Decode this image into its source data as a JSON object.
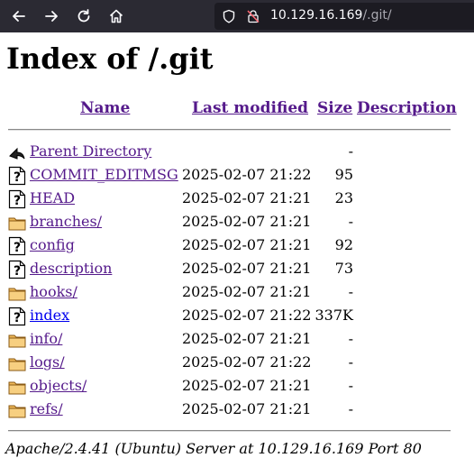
{
  "browser": {
    "url_host": "10.129.16.169",
    "url_path": "/.git/"
  },
  "page": {
    "title": "Index of /.git",
    "columns": {
      "name": "Name",
      "last_modified": "Last modified",
      "size": "Size",
      "description": "Description"
    },
    "rows": [
      {
        "icon": "parent-directory-icon",
        "name": "Parent Directory",
        "date": "",
        "size": "-"
      },
      {
        "icon": "unknown-file-icon",
        "name": "COMMIT_EDITMSG",
        "date": "2025-02-07 21:22",
        "size": "95"
      },
      {
        "icon": "unknown-file-icon",
        "name": "HEAD",
        "date": "2025-02-07 21:21",
        "size": "23"
      },
      {
        "icon": "folder-icon",
        "name": "branches/",
        "date": "2025-02-07 21:21",
        "size": "-"
      },
      {
        "icon": "unknown-file-icon",
        "name": "config",
        "date": "2025-02-07 21:21",
        "size": "92"
      },
      {
        "icon": "unknown-file-icon",
        "name": "description",
        "date": "2025-02-07 21:21",
        "size": "73"
      },
      {
        "icon": "folder-icon",
        "name": "hooks/",
        "date": "2025-02-07 21:21",
        "size": "-"
      },
      {
        "icon": "unknown-file-icon",
        "name": "index",
        "date": "2025-02-07 21:22",
        "size": "337K"
      },
      {
        "icon": "folder-icon",
        "name": "info/",
        "date": "2025-02-07 21:21",
        "size": "-"
      },
      {
        "icon": "folder-icon",
        "name": "logs/",
        "date": "2025-02-07 21:22",
        "size": "-"
      },
      {
        "icon": "folder-icon",
        "name": "objects/",
        "date": "2025-02-07 21:21",
        "size": "-"
      },
      {
        "icon": "folder-icon",
        "name": "refs/",
        "date": "2025-02-07 21:21",
        "size": "-"
      }
    ],
    "footer": "Apache/2.4.41 (Ubuntu) Server at 10.129.16.169 Port 80"
  },
  "colors": {
    "toolbar_bg": "#2b2a33",
    "visited_link": "#551a8b",
    "unvisited_link": "#0000ee"
  }
}
